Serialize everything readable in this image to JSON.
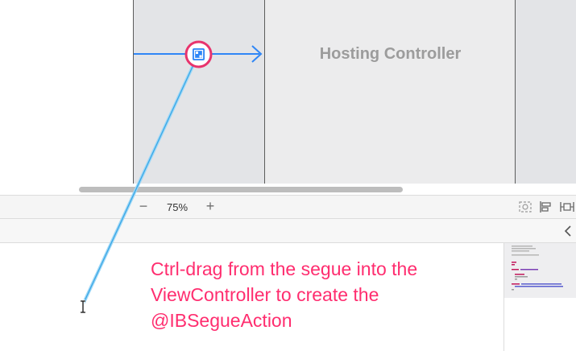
{
  "storyboard": {
    "hosting_scene_title": "Hosting Controller"
  },
  "zoom_bar": {
    "minus_label": "−",
    "zoom_level": "75%",
    "plus_label": "+"
  },
  "annotation": {
    "text": "Ctrl-drag from the segue into the\nViewController to create the\n@IBSegueAction"
  },
  "colors": {
    "accent_blue": "#2f86f6",
    "annotation_pink": "#ff2d6f",
    "drag_line": "#6ec6f5"
  },
  "icons": [
    "segue-icon",
    "zoom-minus-icon",
    "zoom-plus-icon",
    "scene-preview-icon",
    "align-icon",
    "pin-icon",
    "chevron-left-icon",
    "ibeam-cursor-icon"
  ]
}
